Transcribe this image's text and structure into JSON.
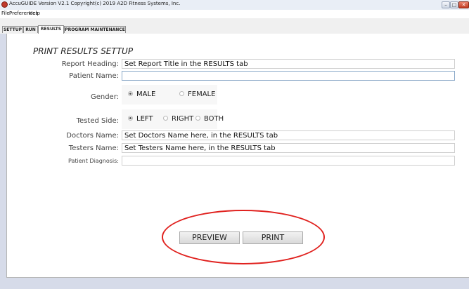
{
  "window": {
    "title": "AccuGUIDE Version V2.1 Copyright(c) 2019 A2D Fitness Systems, Inc.",
    "minimize": "–",
    "maximize": "□",
    "close": "✕"
  },
  "menu": {
    "file": "File",
    "preferences": "Preferences",
    "help": "Help"
  },
  "tabs": {
    "settup": "SETTUP",
    "run": "RUN",
    "results": "RESULTS",
    "program_maintenance": "PROGRAM MAINTENANCE",
    "active": "RESULTS"
  },
  "form": {
    "heading": "PRINT RESULTS SETTUP",
    "report_heading": {
      "label": "Report Heading:",
      "value": "Set Report Title in the RESULTS tab"
    },
    "patient_name": {
      "label": "Patient Name:",
      "value": ""
    },
    "gender": {
      "label": "Gender:",
      "male": "MALE",
      "female": "FEMALE",
      "selected": "MALE"
    },
    "tested_side": {
      "label": "Tested Side:",
      "left": "LEFT",
      "right": "RIGHT",
      "both": "BOTH",
      "selected": "LEFT"
    },
    "doctors_name": {
      "label": "Doctors Name:",
      "value": "Set Doctors Name here, in the RESULTS tab"
    },
    "testers_name": {
      "label": "Testers Name:",
      "value": "Set Testers Name here, in the RESULTS tab"
    },
    "patient_diagnosis": {
      "label": "Patient Diagnosis:",
      "value": ""
    }
  },
  "buttons": {
    "preview": "PREVIEW",
    "print": "PRINT"
  },
  "colors": {
    "highlight_oval": "#e0211e",
    "window_bg": "#d6dbe9"
  }
}
